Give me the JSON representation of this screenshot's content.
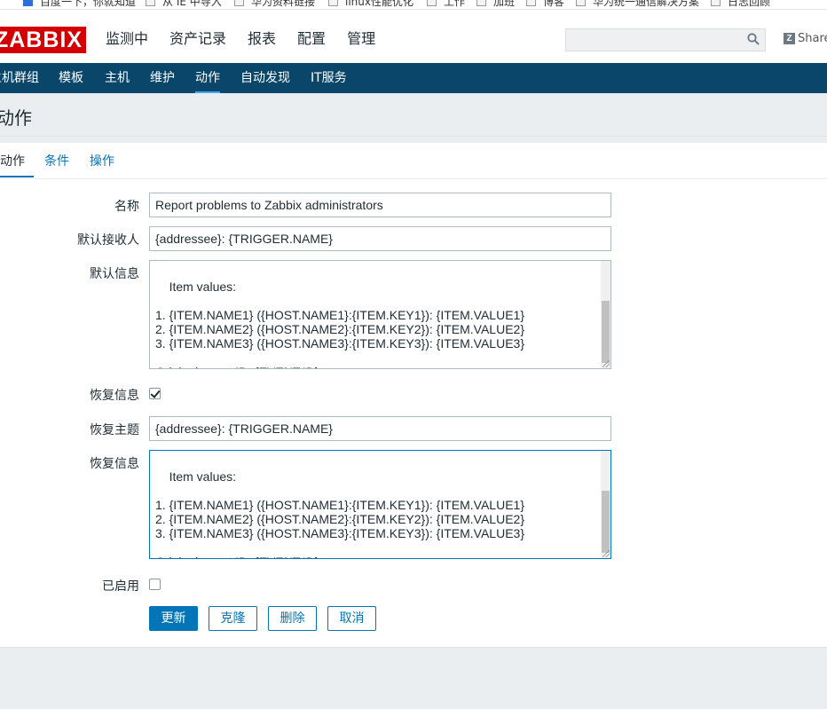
{
  "bookmarks": [
    "百度一下，你就知道",
    "从 IE 中导入",
    "华为资料链接",
    "linux性能优化",
    "工作",
    "加班",
    "博客",
    "华为统一通信解决方案",
    "日志回顾"
  ],
  "logo": "ZABBIX",
  "main_menu": [
    "监测中",
    "资产记录",
    "报表",
    "配置",
    "管理"
  ],
  "search": {
    "placeholder": "",
    "icon": "search-icon"
  },
  "share": {
    "icon": "Z",
    "label": "Share"
  },
  "sub_menu": [
    "主机群组",
    "模板",
    "主机",
    "维护",
    "动作",
    "自动发现",
    "IT服务"
  ],
  "page_title": "动作",
  "tabs": [
    "动作",
    "条件",
    "操作"
  ],
  "form": {
    "name_label": "名称",
    "name_value": "Report problems to Zabbix administrators",
    "default_subject_label": "默认接收人",
    "default_subject_value": "{addressee}: {TRIGGER.NAME}",
    "default_message_label": "默认信息",
    "default_message_value": "Item values:\n\n1. {ITEM.NAME1} ({HOST.NAME1}:{ITEM.KEY1}): {ITEM.VALUE1}\n2. {ITEM.NAME2} ({HOST.NAME2}:{ITEM.KEY2}): {ITEM.VALUE2}\n3. {ITEM.NAME3} ({HOST.NAME3}:{ITEM.KEY3}): {ITEM.VALUE3}\n\nOriginal event ID: {EVENT.ID}",
    "recovery_message_label": "恢复信息",
    "recovery_message_checked": true,
    "recovery_subject_label": "恢复主题",
    "recovery_subject_value": "{addressee}: {TRIGGER.NAME}",
    "recovery_body_label": "恢复信息",
    "recovery_body_value": "Item values:\n\n1. {ITEM.NAME1} ({HOST.NAME1}:{ITEM.KEY1}): {ITEM.VALUE1}\n2. {ITEM.NAME2} ({HOST.NAME2}:{ITEM.KEY2}): {ITEM.VALUE2}\n3. {ITEM.NAME3} ({HOST.NAME3}:{ITEM.KEY3}): {ITEM.VALUE3}\n\nOriginal event ID: {EVENT.ID}",
    "enabled_label": "已启用",
    "enabled_checked": false
  },
  "buttons": {
    "update": "更新",
    "clone": "克隆",
    "delete": "删除",
    "cancel": "取消"
  },
  "colors": {
    "accent": "#0275b8",
    "subnav": "#0a466a",
    "logo": "#d40000"
  }
}
